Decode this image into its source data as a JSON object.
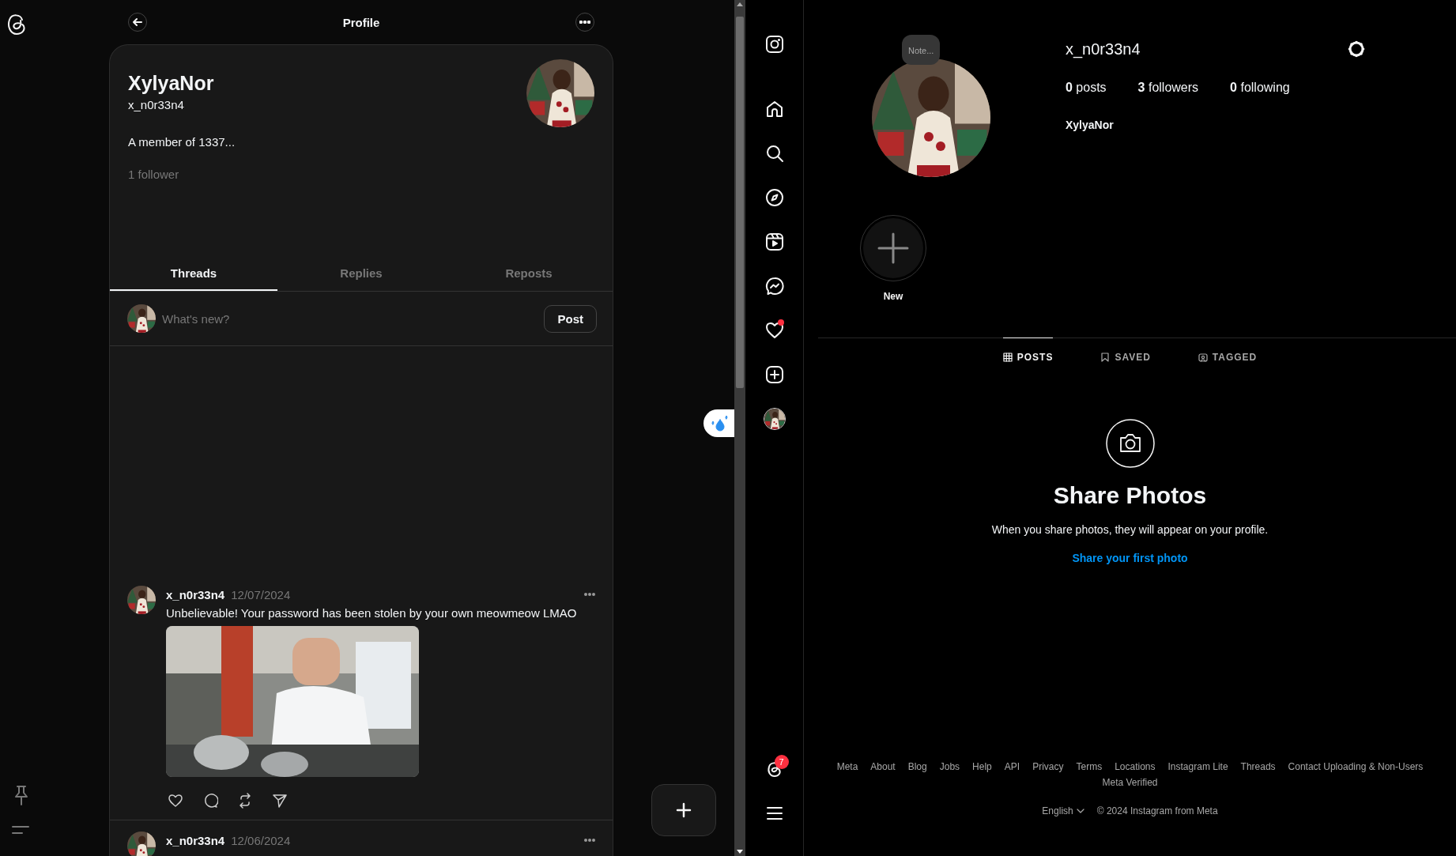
{
  "threads_header": {
    "title": "Profile"
  },
  "profile": {
    "name": "XylyaNor",
    "handle": "x_n0r33n4",
    "bio": "A member of 1337...",
    "followers": "1 follower"
  },
  "tabs": [
    {
      "label": "Threads",
      "selected": true
    },
    {
      "label": "Replies",
      "selected": false
    },
    {
      "label": "Reposts",
      "selected": false
    }
  ],
  "composer": {
    "placeholder": "What's new?",
    "button": "Post"
  },
  "posts": [
    {
      "author": "x_n0r33n4",
      "date": "12/07/2024",
      "text": "Unbelievable! Your password has been stolen by your own meowmeow LMAO"
    },
    {
      "author": "x_n0r33n4",
      "date": "12/06/2024"
    }
  ],
  "instagram_nav": {
    "items": [
      {
        "kind": "logo"
      },
      {
        "kind": "home"
      },
      {
        "kind": "search"
      },
      {
        "kind": "explore"
      },
      {
        "kind": "reels"
      },
      {
        "kind": "messages"
      },
      {
        "kind": "notifications",
        "dot": true
      },
      {
        "kind": "create"
      },
      {
        "kind": "profile"
      }
    ],
    "bottom": [
      {
        "kind": "threads",
        "badge": "7"
      },
      {
        "kind": "menu"
      }
    ]
  },
  "instagram_profile": {
    "note": "Note...",
    "username": "x_n0r33n4",
    "stats": [
      "**0** posts",
      "**3** followers",
      "**0** following"
    ],
    "name": "XylyaNor",
    "highlights": [
      {
        "label": "New"
      }
    ],
    "tabs": [
      {
        "label": "POSTS",
        "kind": "grid",
        "selected": true
      },
      {
        "label": "SAVED",
        "kind": "bookmark",
        "selected": false
      },
      {
        "label": "TAGGED",
        "kind": "tag",
        "selected": false
      }
    ],
    "empty": {
      "title": "Share Photos",
      "text": "When you share photos, they will appear on your profile.",
      "link": "Share your first photo"
    },
    "footer": {
      "links": [
        "Meta",
        "About",
        "Blog",
        "Jobs",
        "Help",
        "API",
        "Privacy",
        "Terms",
        "Locations",
        "Instagram Lite",
        "Threads",
        "Contact Uploading & Non-Users",
        "Meta Verified"
      ],
      "language": "English",
      "copyright": "© 2024 Instagram from Meta"
    }
  }
}
